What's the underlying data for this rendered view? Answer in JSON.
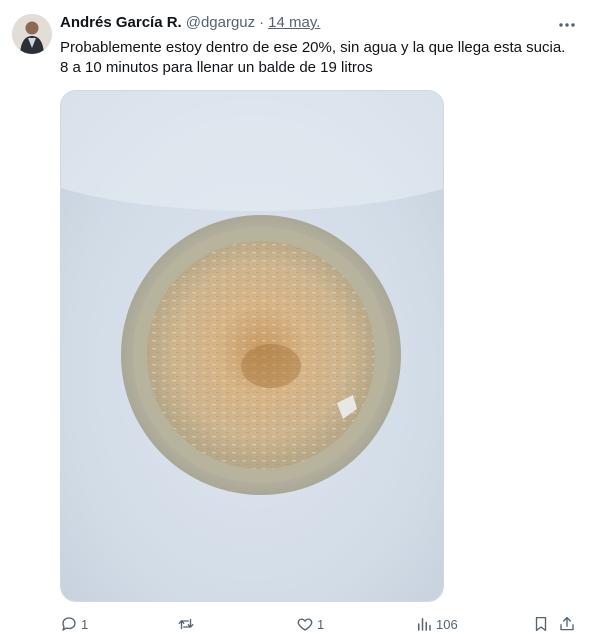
{
  "author": {
    "name": "Andrés García R.",
    "handle": "@dgarguz",
    "separator": "·",
    "date": "14 may."
  },
  "tweet": {
    "line1": "Probablemente estoy dentro de ese 20%, sin agua y la que llega esta sucia.",
    "line2": "8 a 10 minutos para llenar un balde de 19 litros"
  },
  "media": {
    "icon": "photo-bucket-dirty-water"
  },
  "actions": {
    "replies": "1",
    "reposts": "",
    "likes": "1",
    "views": "106"
  },
  "icons": {
    "reply": "reply-icon",
    "repost": "repost-icon",
    "like": "like-icon",
    "views": "views-icon",
    "bookmark": "bookmark-icon",
    "share": "share-icon",
    "more": "more-icon"
  },
  "colors": {
    "text": "#0f1419",
    "secondary": "#536471",
    "border": "#cfd9de"
  }
}
